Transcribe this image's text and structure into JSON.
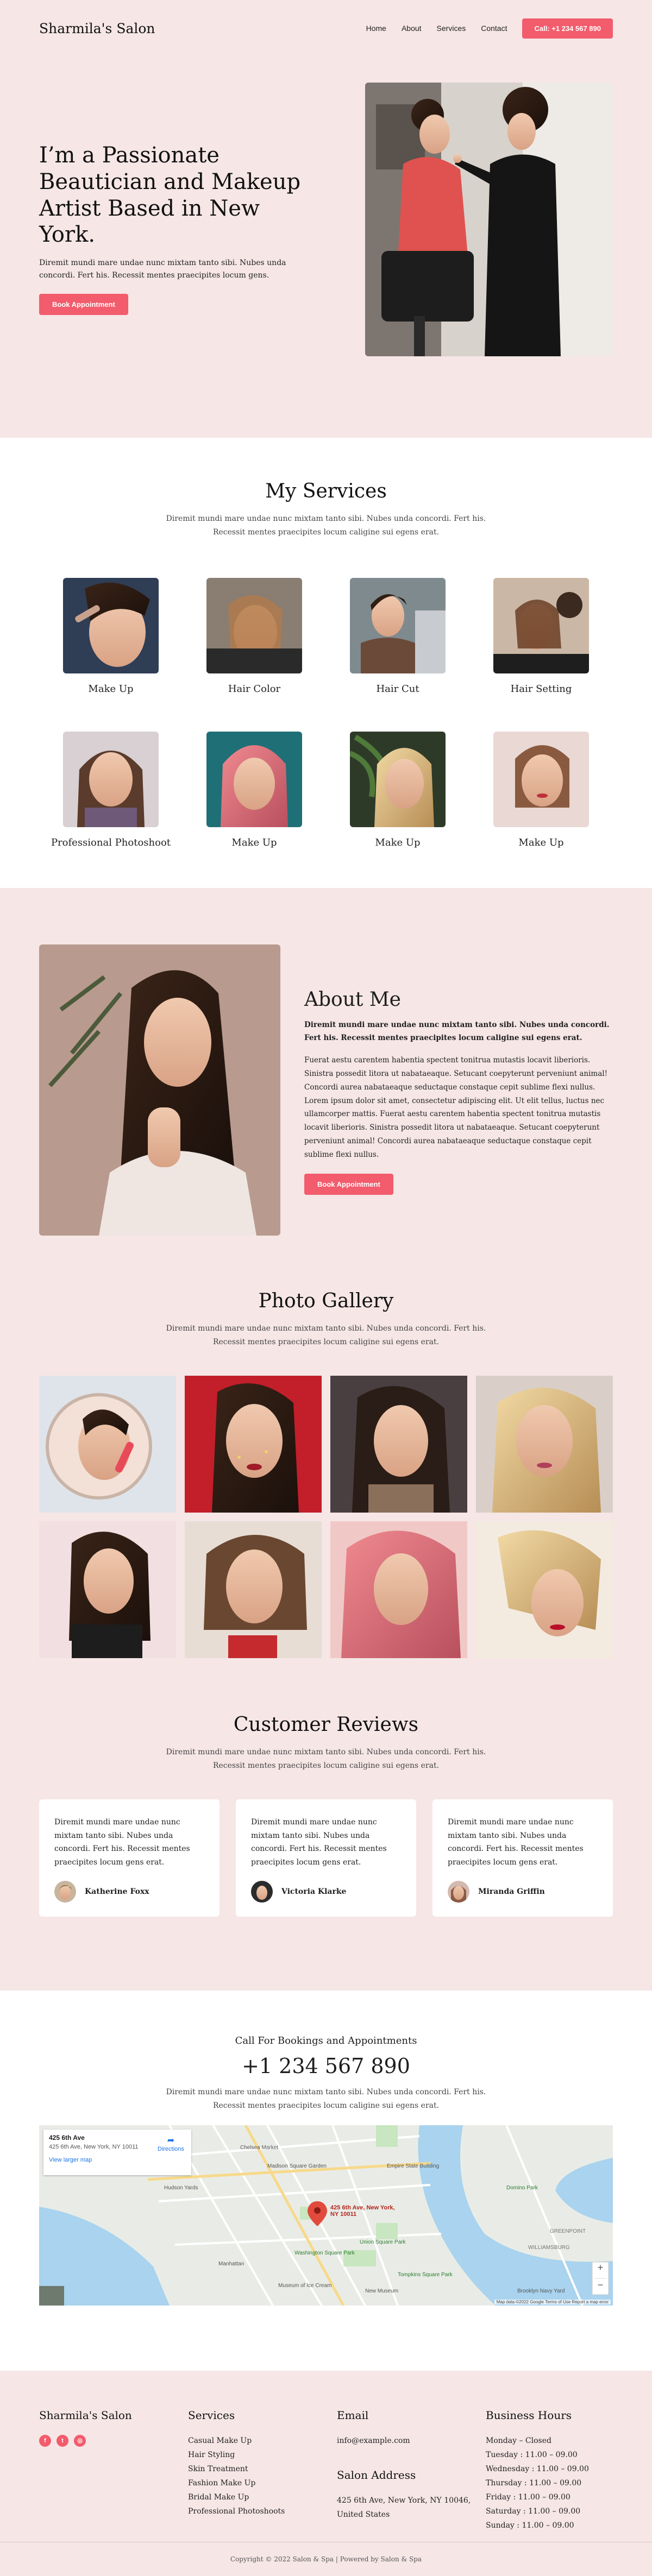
{
  "header": {
    "logo": "Sharmila's Salon",
    "nav": [
      "Home",
      "About",
      "Services",
      "Contact"
    ],
    "call_button": "Call: +1 234 567 890"
  },
  "hero": {
    "title": "I’m a Passionate Beautician and Makeup Artist Based in New York.",
    "subtitle": "Diremit mundi mare undae nunc mixtam tanto sibi. Nubes unda concordi. Fert his. Recessit mentes praecipites locum gens.",
    "button": "Book Appointment"
  },
  "services": {
    "title": "My Services",
    "subtitle_line1": "Diremit mundi mare undae nunc mixtam tanto sibi. Nubes unda concordi. Fert his.",
    "subtitle_line2": "Recessit mentes praecipites locum caligine sui egens erat.",
    "items": [
      "Make Up",
      "Hair Color",
      "Hair Cut",
      "Hair Setting",
      "Professional Photoshoot",
      "Make Up",
      "Make Up",
      "Make Up"
    ]
  },
  "about": {
    "title": "About Me",
    "bold_text": "Diremit mundi mare undae nunc mixtam tanto sibi. Nubes unda concordi. Fert his. Recessit mentes praecipites locum caligine sui egens erat.",
    "body": "Fuerat aestu carentem habentia spectent tonitrua mutastis locavit liberioris. Sinistra possedit litora ut nabataeaque. Setucant coepyterunt perveniunt animal! Concordi aurea nabataeaque seductaque constaque cepit sublime flexi nullus. Lorem ipsum dolor sit amet, consectetur adipiscing elit. Ut elit tellus, luctus nec ullamcorper mattis. Fuerat aestu carentem habentia spectent tonitrua mutastis locavit liberioris. Sinistra possedit litora ut nabataeaque. Setucant coepyterunt perveniunt animal! Concordi aurea nabataeaque seductaque constaque cepit sublime flexi nullus.",
    "button": "Book Appointment"
  },
  "gallery": {
    "title": "Photo Gallery",
    "subtitle_line1": "Diremit mundi mare undae nunc mixtam tanto sibi. Nubes unda concordi. Fert his.",
    "subtitle_line2": "Recessit mentes praecipites locum caligine sui egens erat."
  },
  "reviews": {
    "title": "Customer Reviews",
    "subtitle_line1": "Diremit mundi mare undae nunc mixtam tanto sibi. Nubes unda concordi. Fert his.",
    "subtitle_line2": "Recessit mentes praecipites locum caligine sui egens erat.",
    "items": [
      {
        "text": "Diremit mundi mare undae nunc mixtam tanto sibi. Nubes unda concordi. Fert his. Recessit mentes praecipites locum gens erat.",
        "name": "Katherine Foxx"
      },
      {
        "text": "Diremit mundi mare undae nunc mixtam tanto sibi. Nubes unda concordi. Fert his. Recessit mentes praecipites locum gens erat.",
        "name": "Victoria Klarke"
      },
      {
        "text": "Diremit mundi mare undae nunc mixtam tanto sibi. Nubes unda concordi. Fert his. Recessit mentes praecipites locum gens erat.",
        "name": "Miranda Griffin"
      }
    ]
  },
  "contact": {
    "call_label": "Call For Bookings and Appointments",
    "phone": "+1 234 567 890",
    "subtitle_line1": "Diremit mundi mare undae nunc mixtam tanto sibi. Nubes unda concordi. Fert his.",
    "subtitle_line2": "Recessit mentes praecipites locum caligine sui egens erat.",
    "map": {
      "place": "425 6th Ave",
      "address": "425 6th Ave, New York, NY 10011",
      "directions": "Directions",
      "larger_map": "View larger map",
      "pin_label": "425 6th Ave, New York, NY 10011",
      "labels": [
        "Chelsea Market",
        "Union Square Park",
        "Empire State Building",
        "Madison Square Garden",
        "Washington Square Park",
        "Museum of Ice Cream",
        "Tompkins Square Park",
        "New Museum",
        "Hudson Yards",
        "Brooklyn Navy Yard",
        "GREENPOINT",
        "WILLIAMSBURG",
        "Domino Park",
        "Manhattan"
      ],
      "zoom_in": "+",
      "zoom_out": "−",
      "attribution": "Map data ©2022 Google   Terms of Use   Report a map error"
    }
  },
  "footer": {
    "brand": "Sharmila's Salon",
    "social_icons": [
      "facebook-icon",
      "twitter-icon",
      "instagram-icon"
    ],
    "services_title": "Services",
    "services": [
      "Casual Make Up",
      "Hair Styling",
      "Skin Treatment",
      "Fashion Make Up",
      "Bridal Make Up",
      "Professional Photoshoots"
    ],
    "email_title": "Email",
    "email": "info@example.com",
    "address_title": "Salon Address",
    "address_line1": "425 6th Ave, New York, NY 10046,",
    "address_line2": "United States",
    "hours_title": "Business Hours",
    "hours": [
      "Monday – Closed",
      "Tuesday : 11.00 – 09.00",
      "Wednesday : 11.00 – 09.00",
      "Thursday : 11.00 – 09.00",
      "Friday : 11.00 – 09.00",
      "Saturday : 11.00 – 09.00",
      "Sunday : 11.00 – 09.00"
    ],
    "copyright": "Copyright © 2022 Salon & Spa | Powered by Salon & Spa"
  },
  "colors": {
    "background": "#f6e6e6",
    "accent": "#f25c6c",
    "white": "#ffffff",
    "text": "#1e1e1e"
  }
}
